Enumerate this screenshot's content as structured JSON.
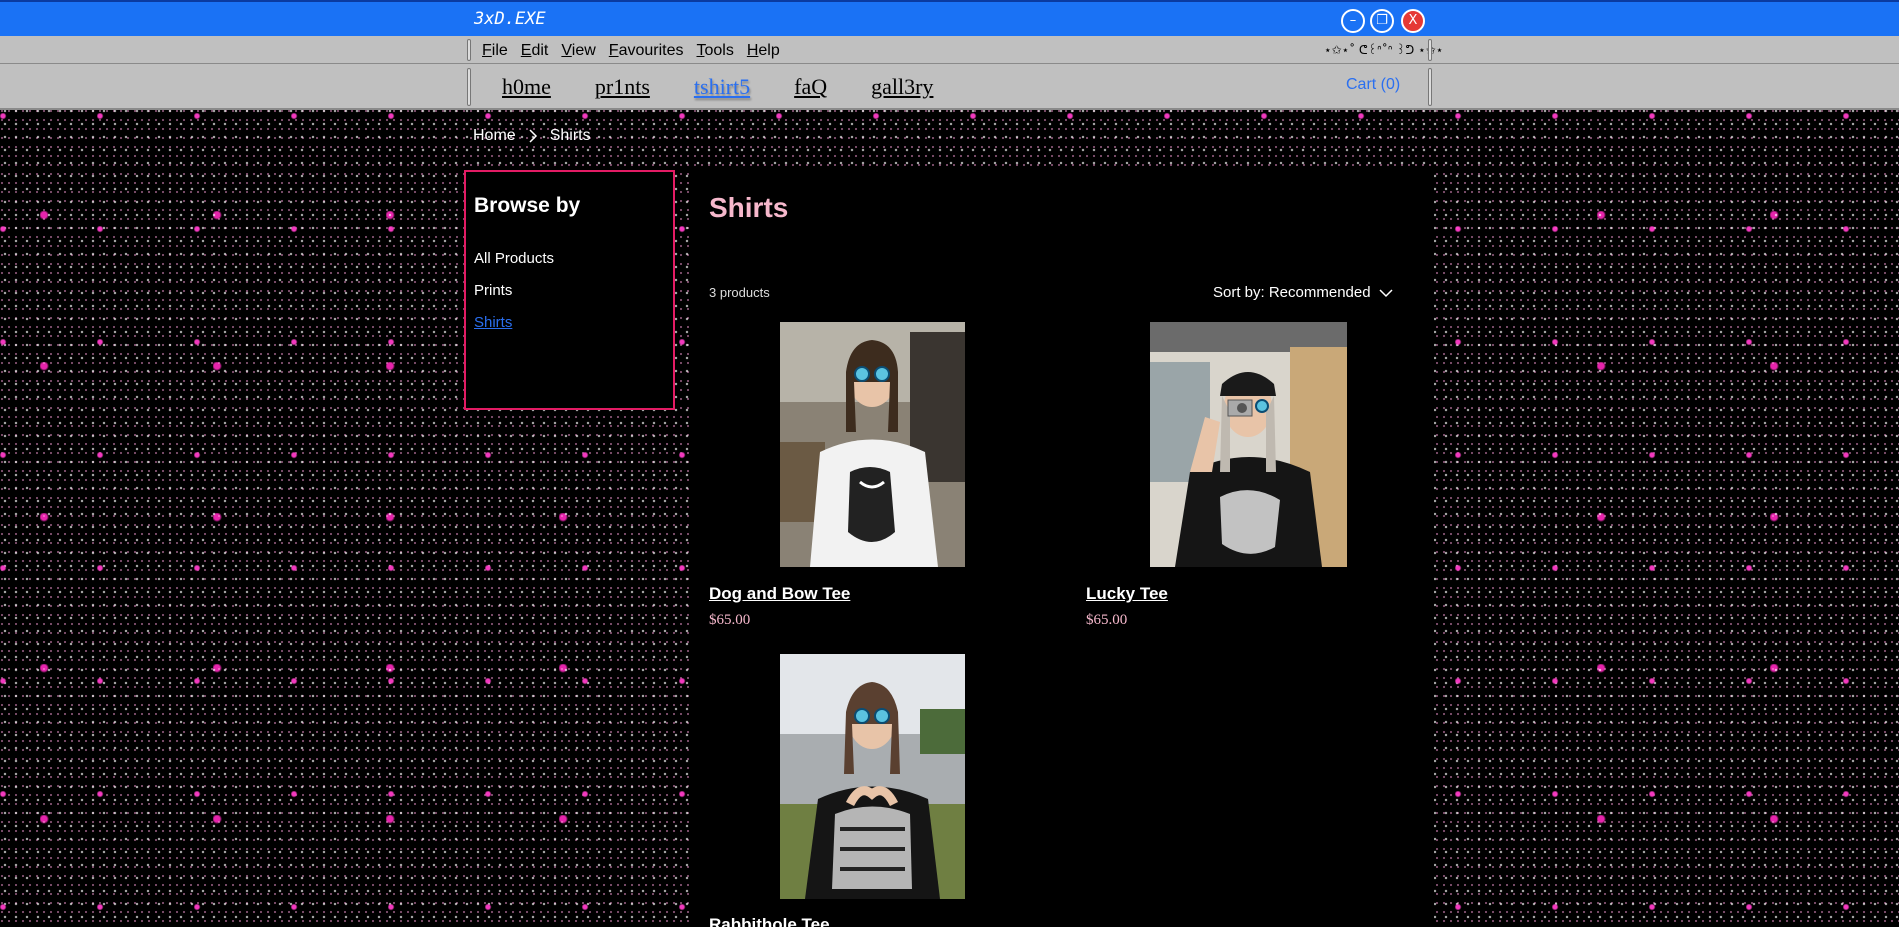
{
  "window": {
    "title": "3xD.EXE",
    "minimize_label": "–",
    "maximize_label": "❐",
    "close_label": "X"
  },
  "menubar": {
    "items": [
      {
        "label": "File"
      },
      {
        "label": "Edit"
      },
      {
        "label": "View"
      },
      {
        "label": "Favourites"
      },
      {
        "label": "Tools"
      },
      {
        "label": "Help"
      }
    ],
    "decoration": "⋆✩⋆˚ ᕦ꒰ᐢ˚ᐢ ꒱ᕤ ⋆✩⋆"
  },
  "nav": {
    "items": [
      {
        "label": "h0me"
      },
      {
        "label": "pr1nts"
      },
      {
        "label": "tshirt5",
        "active": true
      },
      {
        "label": "faQ"
      },
      {
        "label": "gall3ry"
      }
    ],
    "cart": "Cart (0)"
  },
  "breadcrumb": {
    "home": "Home",
    "current": "Shirts"
  },
  "sidebar": {
    "title": "Browse by",
    "items": [
      {
        "label": "All Products"
      },
      {
        "label": "Prints"
      },
      {
        "label": "Shirts",
        "active": true
      }
    ]
  },
  "main": {
    "title": "Shirts",
    "count": "3 products",
    "sort_label": "Sort by: Recommended",
    "products": [
      {
        "name": "Dog and Bow Tee",
        "price": "$65.00"
      },
      {
        "name": "Lucky Tee",
        "price": "$65.00"
      },
      {
        "name": "Rabbithole Tee",
        "price": ""
      }
    ]
  },
  "colors": {
    "titlebar": "#1a72f5",
    "chrome": "#c0c0c0",
    "accent_pink": "#e31b64",
    "title_pink": "#f6b8cc",
    "link_blue": "#2a6ff0"
  }
}
